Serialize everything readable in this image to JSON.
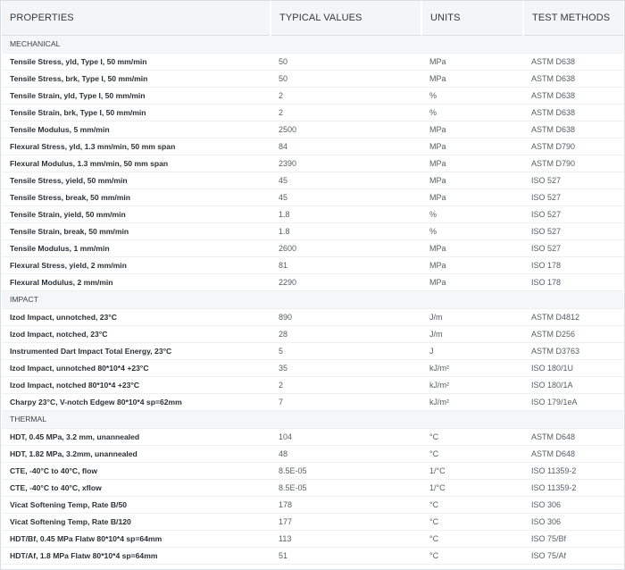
{
  "header": {
    "properties": "PROPERTIES",
    "typical_values": "TYPICAL VALUES",
    "units": "UNITS",
    "test_methods": "TEST METHODS"
  },
  "sections": [
    {
      "title": "MECHANICAL",
      "rows": [
        {
          "property": "Tensile Stress, yld, Type I, 50 mm/min",
          "value": "50",
          "unit": "MPa",
          "method": "ASTM D638"
        },
        {
          "property": "Tensile Stress, brk, Type I, 50 mm/min",
          "value": "50",
          "unit": "MPa",
          "method": "ASTM D638"
        },
        {
          "property": "Tensile Strain, yld, Type I, 50 mm/min",
          "value": "2",
          "unit": "%",
          "method": "ASTM D638"
        },
        {
          "property": "Tensile Strain, brk, Type I, 50 mm/min",
          "value": "2",
          "unit": "%",
          "method": "ASTM D638"
        },
        {
          "property": "Tensile Modulus, 5 mm/min",
          "value": "2500",
          "unit": "MPa",
          "method": "ASTM D638"
        },
        {
          "property": "Flexural Stress, yld, 1.3 mm/min, 50 mm span",
          "value": "84",
          "unit": "MPa",
          "method": "ASTM D790"
        },
        {
          "property": "Flexural Modulus, 1.3 mm/min, 50 mm span",
          "value": "2390",
          "unit": "MPa",
          "method": "ASTM D790"
        },
        {
          "property": "Tensile Stress, yield, 50 mm/min",
          "value": "45",
          "unit": "MPa",
          "method": "ISO 527"
        },
        {
          "property": "Tensile Stress, break, 50 mm/min",
          "value": "45",
          "unit": "MPa",
          "method": "ISO 527"
        },
        {
          "property": "Tensile Strain, yield, 50 mm/min",
          "value": "1.8",
          "unit": "%",
          "method": "ISO 527"
        },
        {
          "property": "Tensile Strain, break, 50 mm/min",
          "value": "1.8",
          "unit": "%",
          "method": "ISO 527"
        },
        {
          "property": "Tensile Modulus, 1 mm/min",
          "value": "2600",
          "unit": "MPa",
          "method": "ISO 527"
        },
        {
          "property": "Flexural Stress, yield, 2 mm/min",
          "value": "81",
          "unit": "MPa",
          "method": "ISO 178"
        },
        {
          "property": "Flexural Modulus, 2 mm/min",
          "value": "2290",
          "unit": "MPa",
          "method": "ISO 178"
        }
      ]
    },
    {
      "title": "IMPACT",
      "rows": [
        {
          "property": "Izod Impact, unnotched, 23°C",
          "value": "890",
          "unit": "J/m",
          "method": "ASTM D4812"
        },
        {
          "property": "Izod Impact, notched, 23°C",
          "value": "28",
          "unit": "J/m",
          "method": "ASTM D256"
        },
        {
          "property": "Instrumented Dart Impact Total Energy, 23°C",
          "value": "5",
          "unit": "J",
          "method": "ASTM D3763"
        },
        {
          "property": "Izod Impact, unnotched 80*10*4 +23°C",
          "value": "35",
          "unit": "kJ/m²",
          "method": "ISO 180/1U"
        },
        {
          "property": "Izod Impact, notched 80*10*4 +23°C",
          "value": "2",
          "unit": "kJ/m²",
          "method": "ISO 180/1A"
        },
        {
          "property": "Charpy 23°C, V-notch Edgew 80*10*4 sp=62mm",
          "value": "7",
          "unit": "kJ/m²",
          "method": "ISO 179/1eA"
        }
      ]
    },
    {
      "title": "THERMAL",
      "rows": [
        {
          "property": "HDT, 0.45 MPa, 3.2 mm, unannealed",
          "value": "104",
          "unit": "°C",
          "method": "ASTM D648"
        },
        {
          "property": "HDT, 1.82 MPa, 3.2mm, unannealed",
          "value": "48",
          "unit": "°C",
          "method": "ASTM D648"
        },
        {
          "property": "CTE, -40°C to 40°C, flow",
          "value": "8.5E-05",
          "unit": "1/°C",
          "method": "ISO 11359-2"
        },
        {
          "property": "CTE, -40°C to 40°C, xflow",
          "value": "8.5E-05",
          "unit": "1/°C",
          "method": "ISO 11359-2"
        },
        {
          "property": "Vicat Softening Temp, Rate B/50",
          "value": "178",
          "unit": "°C",
          "method": "ISO 306"
        },
        {
          "property": "Vicat Softening Temp, Rate B/120",
          "value": "177",
          "unit": "°C",
          "method": "ISO 306"
        },
        {
          "property": "HDT/Bf, 0.45 MPa Flatw 80*10*4 sp=64mm",
          "value": "113",
          "unit": "°C",
          "method": "ISO 75/Bf"
        },
        {
          "property": "HDT/Af, 1.8 MPa Flatw 80*10*4 sp=64mm",
          "value": "51",
          "unit": "°C",
          "method": "ISO 75/Af"
        }
      ]
    }
  ]
}
